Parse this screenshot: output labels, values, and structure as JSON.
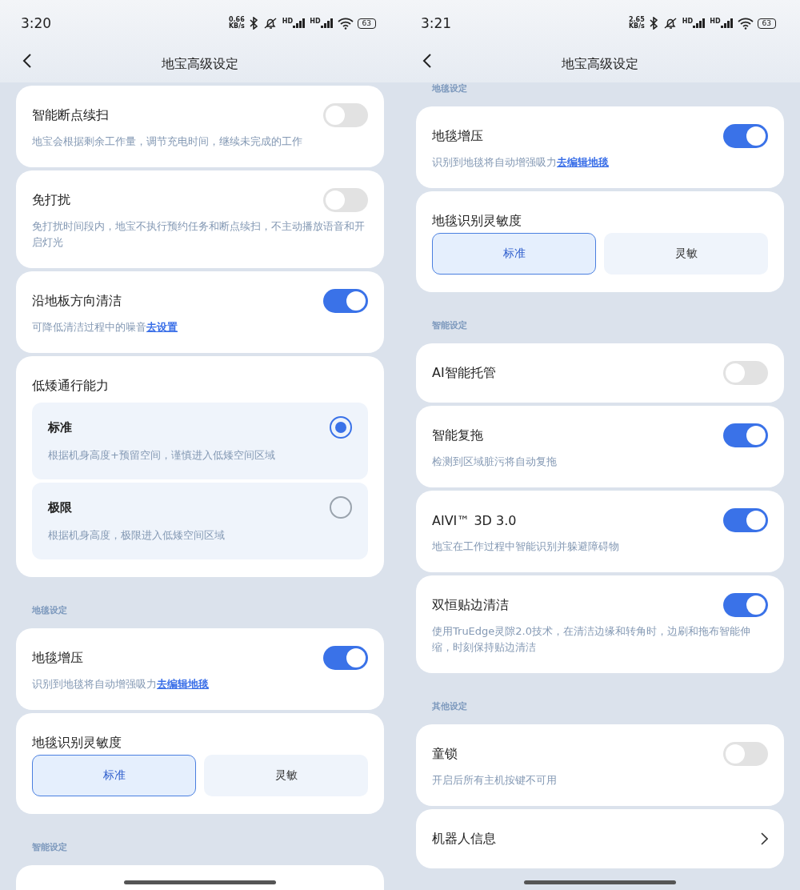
{
  "screens": [
    {
      "status_bar": {
        "time": "3:20",
        "net_speed": "0.66",
        "net_unit": "KB/s",
        "signals": [
          "HD",
          "HD"
        ],
        "battery": "63"
      },
      "nav": {
        "title": "地宝高级设定"
      },
      "sections": [
        {
          "cards": [
            {
              "kind": "toggle",
              "title": "智能断点续扫",
              "on": false,
              "desc": "地宝会根据剩余工作量，调节充电时间，继续未完成的工作"
            },
            {
              "kind": "toggle",
              "title": "免打扰",
              "on": false,
              "desc": "免打扰时间段内，地宝不执行预约任务和断点续扫，不主动播放语音和开启灯光"
            },
            {
              "kind": "toggle",
              "title": "沿地板方向清洁",
              "on": true,
              "desc": "可降低清洁过程中的噪音",
              "link": "去设置"
            },
            {
              "kind": "radio",
              "title": "低矮通行能力",
              "options": [
                {
                  "title": "标准",
                  "desc": "根据机身高度+预留空间，谨慎进入低矮空间区域",
                  "selected": true
                },
                {
                  "title": "极限",
                  "desc": "根据机身高度，极限进入低矮空间区域",
                  "selected": false
                }
              ]
            }
          ]
        },
        {
          "header": "地毯设定",
          "cards": [
            {
              "kind": "toggle",
              "title": "地毯增压",
              "on": true,
              "desc": "识别到地毯将自动增强吸力",
              "link": "去编辑地毯"
            },
            {
              "kind": "segmented",
              "title": "地毯识别灵敏度",
              "options": [
                {
                  "label": "标准",
                  "selected": true
                },
                {
                  "label": "灵敏",
                  "selected": false
                }
              ]
            }
          ]
        },
        {
          "header": "智能设定",
          "cards": [
            {
              "kind": "partial"
            }
          ]
        }
      ]
    },
    {
      "status_bar": {
        "time": "3:21",
        "net_speed": "2.65",
        "net_unit": "KB/s",
        "signals": [
          "HD",
          "HD"
        ],
        "battery": "63"
      },
      "nav": {
        "title": "地宝高级设定"
      },
      "sections": [
        {
          "header": "地毯设定",
          "cards": [
            {
              "kind": "toggle",
              "title": "地毯增压",
              "on": true,
              "desc": "识别到地毯将自动增强吸力",
              "link": "去编辑地毯"
            },
            {
              "kind": "segmented",
              "title": "地毯识别灵敏度",
              "options": [
                {
                  "label": "标准",
                  "selected": true
                },
                {
                  "label": "灵敏",
                  "selected": false
                }
              ]
            }
          ]
        },
        {
          "header": "智能设定",
          "cards": [
            {
              "kind": "toggle",
              "title": "AI智能托管",
              "on": false
            },
            {
              "kind": "toggle",
              "title": "智能复拖",
              "on": true,
              "desc": "检测到区域脏污将自动复拖"
            },
            {
              "kind": "toggle",
              "title": "AIVI™ 3D 3.0",
              "on": true,
              "desc": "地宝在工作过程中智能识别并躲避障碍物"
            },
            {
              "kind": "toggle",
              "title": "双恒贴边清洁",
              "on": true,
              "desc": "使用TruEdge灵隙2.0技术，在清洁边缘和转角时，边刷和拖布智能伸缩，时刻保持贴边清洁"
            }
          ]
        },
        {
          "header": "其他设定",
          "cards": [
            {
              "kind": "toggle",
              "title": "童锁",
              "on": false,
              "desc": "开启后所有主机按键不可用"
            },
            {
              "kind": "nav",
              "title": "机器人信息"
            }
          ]
        }
      ]
    }
  ]
}
